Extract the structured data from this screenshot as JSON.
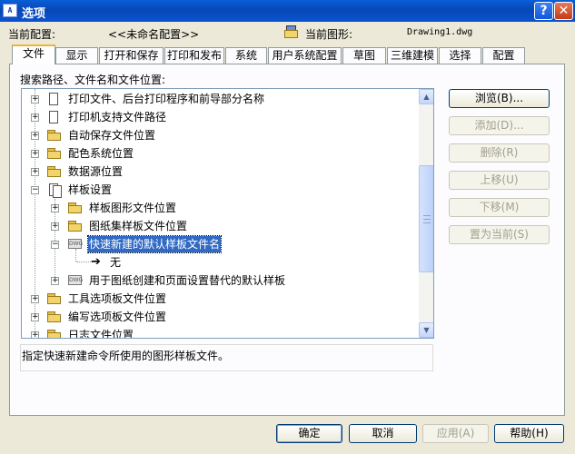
{
  "window": {
    "title": "选项",
    "help_glyph": "?",
    "close_glyph": "✕"
  },
  "header": {
    "current_profile_label": "当前配置:",
    "current_profile_value": "<<未命名配置>>",
    "current_drawing_label": "当前图形:",
    "current_drawing_value": "Drawing1.dwg"
  },
  "tabs": [
    "文件",
    "显示",
    "打开和保存",
    "打印和发布",
    "系统",
    "用户系统配置",
    "草图",
    "三维建模",
    "选择",
    "配置"
  ],
  "active_tab": "文件",
  "search_label": "搜索路径、文件名和文件位置:",
  "tree": [
    {
      "label": "打印文件、后台打印程序和前导部分名称",
      "icon": "document-icon",
      "expanded": false
    },
    {
      "label": "打印机支持文件路径",
      "icon": "document-icon",
      "expanded": false
    },
    {
      "label": "自动保存文件位置",
      "icon": "folder-icon",
      "expanded": false
    },
    {
      "label": "配色系统位置",
      "icon": "folder-icon",
      "expanded": false
    },
    {
      "label": "数据源位置",
      "icon": "folder-icon",
      "expanded": false
    },
    {
      "label": "样板设置",
      "icon": "templates-icon",
      "expanded": true
    },
    {
      "label": "样板图形文件位置",
      "icon": "folder-icon",
      "expanded": false
    },
    {
      "label": "图纸集样板文件位置",
      "icon": "folder-icon",
      "expanded": false
    },
    {
      "label": "快速新建的默认样板文件名",
      "icon": "dwg-icon",
      "expanded": true,
      "selected": true
    },
    {
      "label": "无",
      "icon": "arrow-right-icon"
    },
    {
      "label": "用于图纸创建和页面设置替代的默认样板",
      "icon": "dwg-icon",
      "expanded": false
    },
    {
      "label": "工具选项板文件位置",
      "icon": "folder-icon",
      "expanded": false
    },
    {
      "label": "编写选项板文件位置",
      "icon": "folder-icon",
      "expanded": false
    },
    {
      "label": "日志文件位置",
      "icon": "folder-icon",
      "expanded": false
    }
  ],
  "side_buttons": {
    "browse": "浏览(B)...",
    "add": "添加(D)...",
    "remove": "删除(R)",
    "move_up": "上移(U)",
    "move_down": "下移(M)",
    "set_current": "置为当前(S)"
  },
  "description": "指定快速新建命令所使用的图形样板文件。",
  "footer": {
    "ok": "确定",
    "cancel": "取消",
    "apply": "应用(A)",
    "help": "帮助(H)"
  }
}
